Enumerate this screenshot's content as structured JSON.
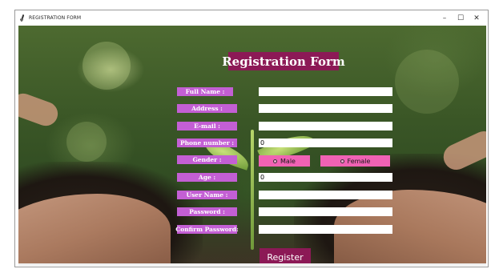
{
  "window": {
    "title": "REGISTRATION FORM",
    "controls": {
      "minimize": "–",
      "maximize": "☐",
      "close": "✕"
    }
  },
  "form": {
    "heading": "Registration Form",
    "labels": {
      "full_name": "Full Name :",
      "address": "Address :",
      "email": "E-mail :",
      "phone": "Phone number :",
      "gender": "Gender :",
      "age": "Age :",
      "username": "User Name :",
      "password": "Password :",
      "confirm_password": "Confirm Password:"
    },
    "values": {
      "full_name": "",
      "address": "",
      "email": "",
      "phone": "0",
      "age": "0",
      "username": "",
      "password": "",
      "confirm_password": ""
    },
    "gender_options": {
      "male": "Male",
      "female": "Female"
    },
    "register_label": "Register"
  },
  "colors": {
    "title_bg": "#8c1956",
    "label_bg": "#c35fd4",
    "radio_bg": "#f062b4",
    "register_bg": "#8c1956"
  },
  "icons": {
    "app": "feather-icon"
  }
}
